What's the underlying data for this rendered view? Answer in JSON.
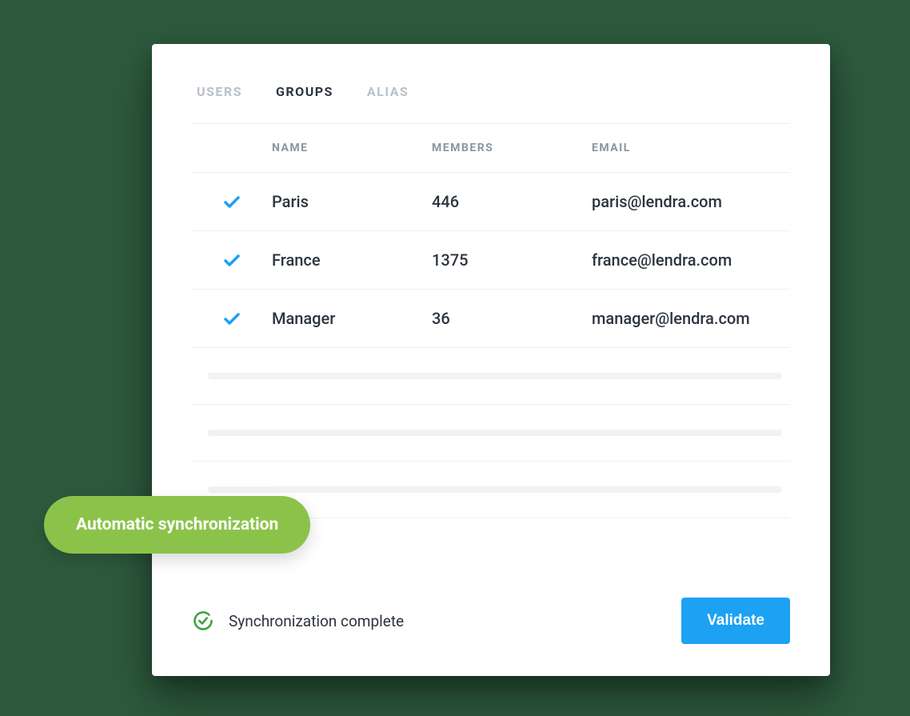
{
  "tabs": {
    "items": [
      {
        "label": "USERS",
        "active": false
      },
      {
        "label": "GROUPS",
        "active": true
      },
      {
        "label": "ALIAS",
        "active": false
      }
    ]
  },
  "table": {
    "headers": {
      "name": "NAME",
      "members": "MEMBERS",
      "email": "EMAIL"
    },
    "rows": [
      {
        "checked": true,
        "name": "Paris",
        "members": "446",
        "email": "paris@lendra.com"
      },
      {
        "checked": true,
        "name": "France",
        "members": "1375",
        "email": "france@lendra.com"
      },
      {
        "checked": true,
        "name": "Manager",
        "members": "36",
        "email": "manager@lendra.com"
      }
    ]
  },
  "status": {
    "text": "Synchronization complete"
  },
  "buttons": {
    "validate": "Validate"
  },
  "pill": {
    "label": "Automatic synchronization"
  }
}
